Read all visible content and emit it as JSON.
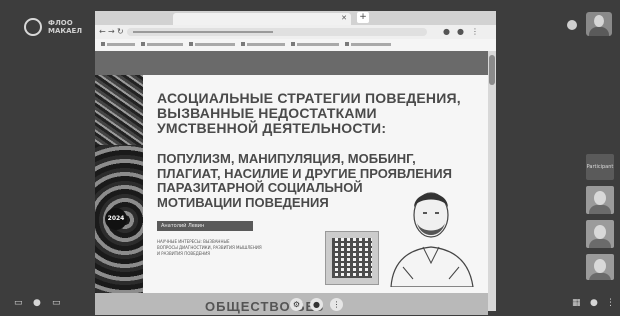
{
  "app": {
    "logo_line1": "ФЛОО",
    "logo_line2": "МАКАЕЛ"
  },
  "slide": {
    "title_lines": [
      "АСОЦИАЛЬНЫЕ СТРАТЕГИИ ПОВЕДЕНИЯ,",
      "ВЫЗВАННЫЕ НЕДОСТАТКАМИ",
      "УМСТВЕННОЙ ДЕЯТЕЛЬНОСТИ:"
    ],
    "subtitle_lines": [
      "ПОПУЛИЗМ, МАНИПУЛЯЦИЯ, МОББИНГ,",
      "ПЛАГИАТ, НАСИЛИЕ И ДРУГИЕ ПРОЯВЛЕНИЯ",
      "ПАРАЗИТАРНОЙ СОЦИАЛЬНОЙ",
      "МОТИВАЦИИ ПОВЕДЕНИЯ"
    ],
    "year_badge": "2024",
    "author": "Анатолий Левин",
    "desc_lines": [
      "НАУЧНЫЕ ИНТЕРЕСЫ: ВЫЗВАННЫЕ",
      "ВОПРОСЫ ДИАГНОСТИКИ, РАЗВИТИЯ МЫШЛЕНИЯ",
      "И РАЗВИТИЯ ПОВЕДЕНИЯ"
    ],
    "footer_partial": "ОБЩЕСТВО  БЕЗ"
  },
  "participants": [
    {
      "label": "Participant"
    }
  ],
  "icons": {
    "tab_close": "✕",
    "tab_new": "+",
    "back": "←",
    "forward": "→",
    "reload": "↻",
    "mic": "🎤",
    "cam": "●",
    "screen": "▭",
    "grid": "▦",
    "more": "⋮",
    "settings": "⚙"
  },
  "colors": {
    "background": "#3d3d3d",
    "slide_bg": "#f6f6f6",
    "title": "#4a4a4a"
  }
}
